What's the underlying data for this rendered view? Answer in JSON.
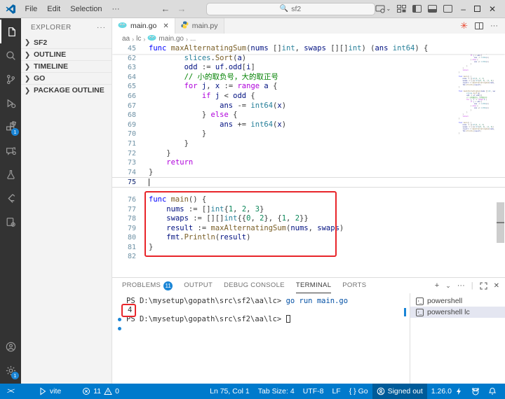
{
  "title_bar": {
    "menus": [
      "File",
      "Edit",
      "Selection",
      "···"
    ],
    "search_value": "sf2",
    "window_buttons": {
      "minimize": "–",
      "close": "✕"
    }
  },
  "activity_bar": {
    "extensions_badge": "1",
    "settings_badge": "1"
  },
  "sidebar": {
    "header": "EXPLORER",
    "more": "···",
    "sections": [
      {
        "label": "SF2"
      },
      {
        "label": "OUTLINE"
      },
      {
        "label": "TIMELINE"
      },
      {
        "label": "GO"
      },
      {
        "label": "PACKAGE OUTLINE"
      }
    ]
  },
  "tabs": [
    {
      "label": "main.go",
      "icon": "go",
      "active": true,
      "closable": true
    },
    {
      "label": "main.py",
      "icon": "python",
      "active": false,
      "closable": false
    }
  ],
  "editor_actions": {
    "run": "✳",
    "more": "···"
  },
  "breadcrumb": [
    {
      "label": "aa"
    },
    {
      "label": "lc"
    },
    {
      "label": "main.go",
      "icon": "go"
    },
    {
      "label": "..."
    }
  ],
  "editor": {
    "sticky_line": {
      "num": "45",
      "segs": [
        [
          "kw",
          "func "
        ],
        [
          "fn",
          "maxAlternatingSum"
        ],
        [
          "pl",
          "("
        ],
        [
          "var",
          "nums"
        ],
        [
          "pl",
          " []"
        ],
        [
          "type",
          "int"
        ],
        [
          "pl",
          ", "
        ],
        [
          "var",
          "swaps"
        ],
        [
          "pl",
          " [][]"
        ],
        [
          "type",
          "int"
        ],
        [
          "pl",
          ") ("
        ],
        [
          "var",
          "ans"
        ],
        [
          "pl",
          " "
        ],
        [
          "type",
          "int64"
        ],
        [
          "pl",
          ") {"
        ]
      ]
    },
    "lines": [
      {
        "num": "62",
        "segs": [
          [
            "pl",
            "        "
          ],
          [
            "type",
            "slices"
          ],
          [
            "pl",
            "."
          ],
          [
            "fn",
            "Sort"
          ],
          [
            "pl",
            "("
          ],
          [
            "var",
            "a"
          ],
          [
            "pl",
            ")"
          ]
        ]
      },
      {
        "num": "63",
        "segs": [
          [
            "pl",
            "        "
          ],
          [
            "var",
            "odd"
          ],
          [
            "pl",
            " := "
          ],
          [
            "var",
            "uf"
          ],
          [
            "pl",
            "."
          ],
          [
            "var",
            "odd"
          ],
          [
            "pl",
            "["
          ],
          [
            "var",
            "i"
          ],
          [
            "pl",
            "]"
          ]
        ]
      },
      {
        "num": "64",
        "segs": [
          [
            "pl",
            "        "
          ],
          [
            "com",
            "// 小的取负号，大的取正号"
          ]
        ]
      },
      {
        "num": "65",
        "segs": [
          [
            "pl",
            "        "
          ],
          [
            "ctrl",
            "for "
          ],
          [
            "var",
            "j"
          ],
          [
            "pl",
            ", "
          ],
          [
            "var",
            "x"
          ],
          [
            "pl",
            " := "
          ],
          [
            "ctrl",
            "range"
          ],
          [
            "pl",
            " "
          ],
          [
            "var",
            "a"
          ],
          [
            "pl",
            " {"
          ]
        ]
      },
      {
        "num": "66",
        "segs": [
          [
            "pl",
            "            "
          ],
          [
            "ctrl",
            "if "
          ],
          [
            "var",
            "j"
          ],
          [
            "pl",
            " < "
          ],
          [
            "var",
            "odd"
          ],
          [
            "pl",
            " {"
          ]
        ]
      },
      {
        "num": "67",
        "segs": [
          [
            "pl",
            "                "
          ],
          [
            "var",
            "ans"
          ],
          [
            "pl",
            " -= "
          ],
          [
            "type",
            "int64"
          ],
          [
            "pl",
            "("
          ],
          [
            "var",
            "x"
          ],
          [
            "pl",
            ")"
          ]
        ]
      },
      {
        "num": "68",
        "segs": [
          [
            "pl",
            "            } "
          ],
          [
            "ctrl",
            "else"
          ],
          [
            "pl",
            " {"
          ]
        ]
      },
      {
        "num": "69",
        "segs": [
          [
            "pl",
            "                "
          ],
          [
            "var",
            "ans"
          ],
          [
            "pl",
            " += "
          ],
          [
            "type",
            "int64"
          ],
          [
            "pl",
            "("
          ],
          [
            "var",
            "x"
          ],
          [
            "pl",
            ")"
          ]
        ]
      },
      {
        "num": "70",
        "segs": [
          [
            "pl",
            "            }"
          ]
        ]
      },
      {
        "num": "71",
        "segs": [
          [
            "pl",
            "        }"
          ]
        ]
      },
      {
        "num": "72",
        "segs": [
          [
            "pl",
            "    }"
          ]
        ]
      },
      {
        "num": "73",
        "segs": [
          [
            "pl",
            "    "
          ],
          [
            "ctrl",
            "return"
          ]
        ]
      },
      {
        "num": "74",
        "segs": [
          [
            "pl",
            "}"
          ]
        ]
      },
      {
        "num": "75",
        "segs": [],
        "current": true,
        "cursor": true
      },
      {
        "num": "76",
        "segs": [
          [
            "kw",
            "func "
          ],
          [
            "fn",
            "main"
          ],
          [
            "pl",
            "() {"
          ]
        ],
        "gap_before": true
      },
      {
        "num": "77",
        "segs": [
          [
            "pl",
            "    "
          ],
          [
            "var",
            "nums"
          ],
          [
            "pl",
            " := []"
          ],
          [
            "type",
            "int"
          ],
          [
            "pl",
            "{"
          ],
          [
            "num2",
            "1"
          ],
          [
            "pl",
            ", "
          ],
          [
            "num2",
            "2"
          ],
          [
            "pl",
            ", "
          ],
          [
            "num2",
            "3"
          ],
          [
            "pl",
            "}"
          ]
        ]
      },
      {
        "num": "78",
        "segs": [
          [
            "pl",
            "    "
          ],
          [
            "var",
            "swaps"
          ],
          [
            "pl",
            " := [][]"
          ],
          [
            "type",
            "int"
          ],
          [
            "pl",
            "{{"
          ],
          [
            "num2",
            "0"
          ],
          [
            "pl",
            ", "
          ],
          [
            "num2",
            "2"
          ],
          [
            "pl",
            "}, {"
          ],
          [
            "num2",
            "1"
          ],
          [
            "pl",
            ", "
          ],
          [
            "num2",
            "2"
          ],
          [
            "pl",
            "}}"
          ]
        ]
      },
      {
        "num": "79",
        "segs": [
          [
            "pl",
            "    "
          ],
          [
            "var",
            "result"
          ],
          [
            "pl",
            " := "
          ],
          [
            "fn",
            "maxAlternatingSum"
          ],
          [
            "pl",
            "("
          ],
          [
            "var",
            "nums"
          ],
          [
            "pl",
            ", "
          ],
          [
            "var",
            "swaps"
          ],
          [
            "pl",
            ")"
          ]
        ]
      },
      {
        "num": "80",
        "segs": [
          [
            "pl",
            "    "
          ],
          [
            "var",
            "fmt"
          ],
          [
            "pl",
            "."
          ],
          [
            "fn",
            "Println"
          ],
          [
            "pl",
            "("
          ],
          [
            "var",
            "result"
          ],
          [
            "pl",
            ")"
          ]
        ]
      },
      {
        "num": "81",
        "segs": [
          [
            "pl",
            "}"
          ]
        ]
      },
      {
        "num": "82",
        "segs": []
      }
    ]
  },
  "panel": {
    "tabs": [
      {
        "label": "PROBLEMS",
        "badge": "11"
      },
      {
        "label": "OUTPUT"
      },
      {
        "label": "DEBUG CONSOLE"
      },
      {
        "label": "TERMINAL",
        "active": true
      },
      {
        "label": "PORTS"
      }
    ],
    "actions": {
      "new": "+",
      "dropdown": "⌄",
      "more": "···",
      "maximize": "⌐",
      "close": "✕"
    }
  },
  "terminal": {
    "lines": [
      {
        "prompt": "PS D:\\mysetup\\gopath\\src\\sf2\\aa\\lc> ",
        "cmd": "go run main.go"
      },
      {
        "output": "4",
        "annotated": true
      },
      {
        "prompt": "PS D:\\mysetup\\gopath\\src\\sf2\\aa\\lc> ",
        "cursor": true,
        "dot": true
      },
      {
        "dot_only": true
      }
    ],
    "list": [
      {
        "label": "powershell",
        "selected": false
      },
      {
        "label": "powershell lc",
        "selected": true
      }
    ]
  },
  "status_bar": {
    "task_label": "vite",
    "errors": "11",
    "warnings": "0",
    "ln_col": "Ln 75, Col 1",
    "tab_size": "Tab Size: 4",
    "encoding": "UTF-8",
    "eol": "LF",
    "language": "{ } Go",
    "signed_out": "Signed out",
    "go_version": "1.26.0",
    "accent": "#007acc",
    "annotation_red": "#e8252a",
    "badge_blue": "#1a85d6"
  }
}
